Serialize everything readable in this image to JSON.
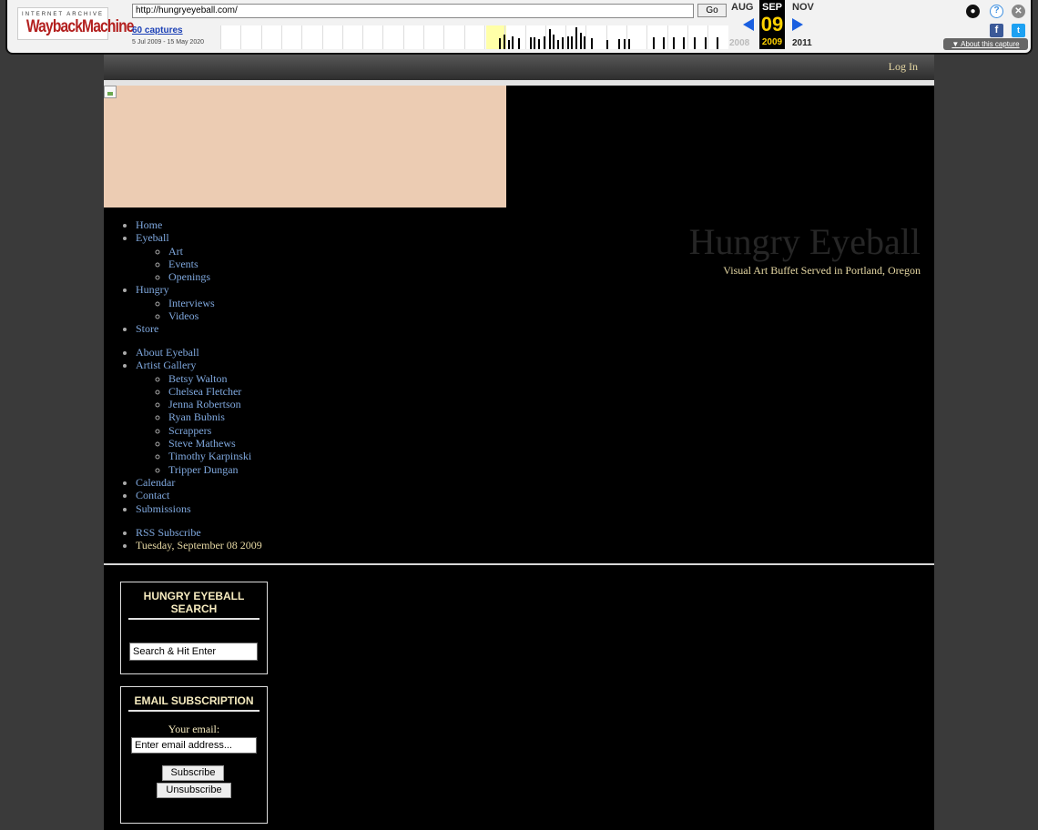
{
  "wayback": {
    "logo_top": "INTERNET ARCHIVE",
    "logo_main": "WaybackMachine",
    "url": "http://hungryeyeball.com/",
    "go_label": "Go",
    "captures": "60 captures",
    "range": "5 Jul 2009 - 15 May 2020",
    "prev_month": "AUG",
    "cur_month": "SEP",
    "next_month": "NOV",
    "cur_day": "09",
    "prev_year": "2008",
    "cur_year": "2009",
    "next_year": "2011",
    "about": "About this capture",
    "icons": [
      "user-icon",
      "help-icon",
      "close-icon",
      "facebook-icon",
      "twitter-icon"
    ],
    "colors": {
      "accent": "#1a5fe0",
      "highlight": "#ffd200",
      "logo": "#b3201f"
    }
  },
  "page": {
    "login": "Log In",
    "title": "Hungry Eyeball",
    "tagline": "Visual Art Buffet Served in Portland, Oregon",
    "nav1": {
      "home": "Home",
      "eyeball": "Eyeball",
      "eyeball_sub": [
        "Art",
        "Events",
        "Openings"
      ],
      "hungry": "Hungry",
      "hungry_sub": [
        "Interviews",
        "Videos"
      ],
      "store": "Store"
    },
    "nav2": {
      "about": "About Eyeball",
      "gallery": "Artist Gallery",
      "artists": [
        "Betsy Walton",
        "Chelsea Fletcher",
        "Jenna Robertson",
        "Ryan Bubnis",
        "Scrappers",
        "Steve Mathews",
        "Timothy Karpinski",
        "Tripper Dungan"
      ],
      "calendar": "Calendar",
      "contact": "Contact",
      "submissions": "Submissions"
    },
    "nav3": {
      "rss": "RSS Subscribe",
      "date": "Tuesday, September 08 2009"
    },
    "search_widget": {
      "title": "HUNGRY EYEBALL SEARCH",
      "input_value": "Search & Hit Enter"
    },
    "email_widget": {
      "title": "EMAIL SUBSCRIPTION",
      "label": "Your email:",
      "input_value": "Enter email address...",
      "subscribe": "Subscribe",
      "unsubscribe": "Unsubscribe"
    },
    "colors": {
      "link": "#7fa8de",
      "cream": "#e7d9a4",
      "header_bg": "#ecccb3"
    }
  }
}
